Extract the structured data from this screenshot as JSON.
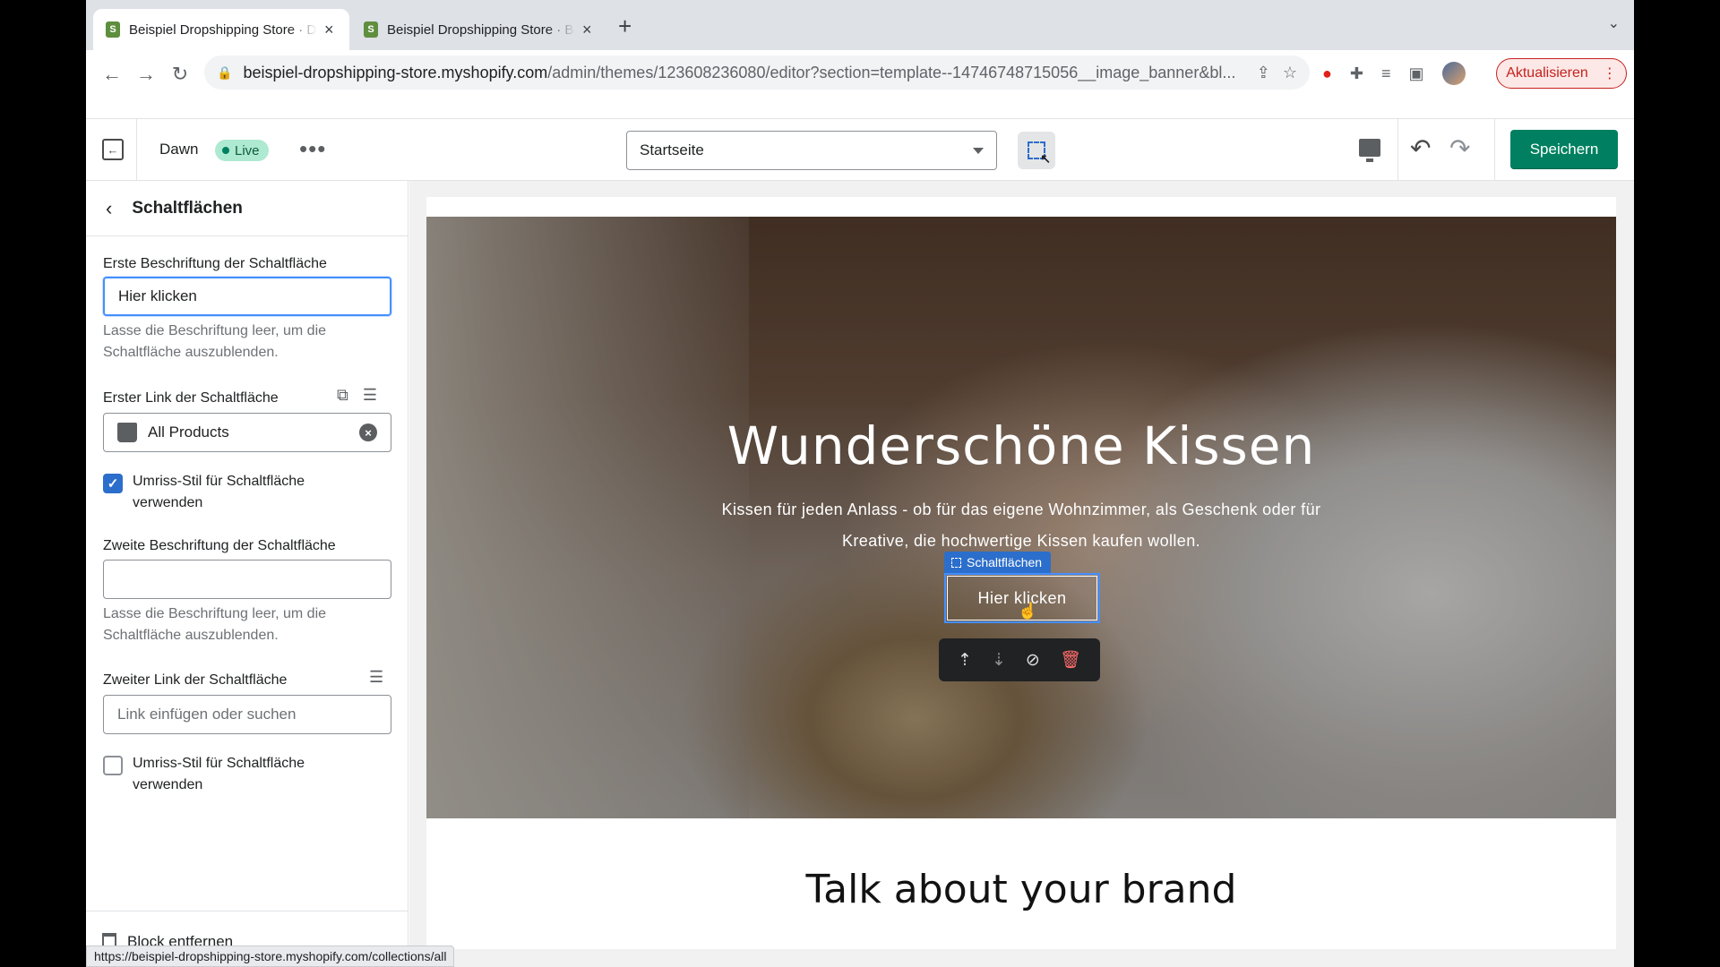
{
  "browser": {
    "tabs": [
      {
        "title": "Beispiel Dropshipping Store · Dawn · Shopify",
        "active": true
      },
      {
        "title": "Beispiel Dropshipping Store · Beispiel",
        "active": false
      }
    ],
    "url_host": "beispiel-dropshipping-store.myshopify.com",
    "url_path": "/admin/themes/123608236080/editor?section=template--14746748715056__image_banner&bl...",
    "update_button": "Aktualisieren",
    "status_url": "https://beispiel-dropshipping-store.myshopify.com/collections/all"
  },
  "editor": {
    "theme_name": "Dawn",
    "live_badge": "Live",
    "page_select": "Startseite",
    "save_label": "Speichern"
  },
  "sidebar": {
    "title": "Schaltflächen",
    "first_label_label": "Erste Beschriftung der Schaltfläche",
    "first_label_value": "Hier klicken",
    "first_label_help": "Lasse die Beschriftung leer, um die Schaltfläche auszublenden.",
    "first_link_label": "Erster Link der Schaltfläche",
    "first_link_value": "All Products",
    "first_outline_label": "Umriss-Stil für Schaltfläche verwenden",
    "first_outline_checked": true,
    "second_label_label": "Zweite Beschriftung der Schaltfläche",
    "second_label_value": "",
    "second_label_help": "Lasse die Beschriftung leer, um die Schaltfläche auszublenden.",
    "second_link_label": "Zweiter Link der Schaltfläche",
    "second_link_placeholder": "Link einfügen oder suchen",
    "second_outline_label": "Umriss-Stil für Schaltfläche verwenden",
    "second_outline_checked": false,
    "remove_block": "Block entfernen"
  },
  "preview": {
    "banner_title": "Wunderschöne Kissen",
    "banner_text": "Kissen für jeden Anlass - ob für das eigene Wohnzimmer, als Geschenk oder für Kreative, die hochwertige Kissen kaufen wollen.",
    "selection_tag": "Schaltflächen",
    "banner_button": "Hier klicken",
    "brand_title": "Talk about your brand"
  },
  "colors": {
    "save_green": "#008060",
    "selection_blue": "#2c6ecb",
    "live_badge_bg": "#aee9d1"
  }
}
